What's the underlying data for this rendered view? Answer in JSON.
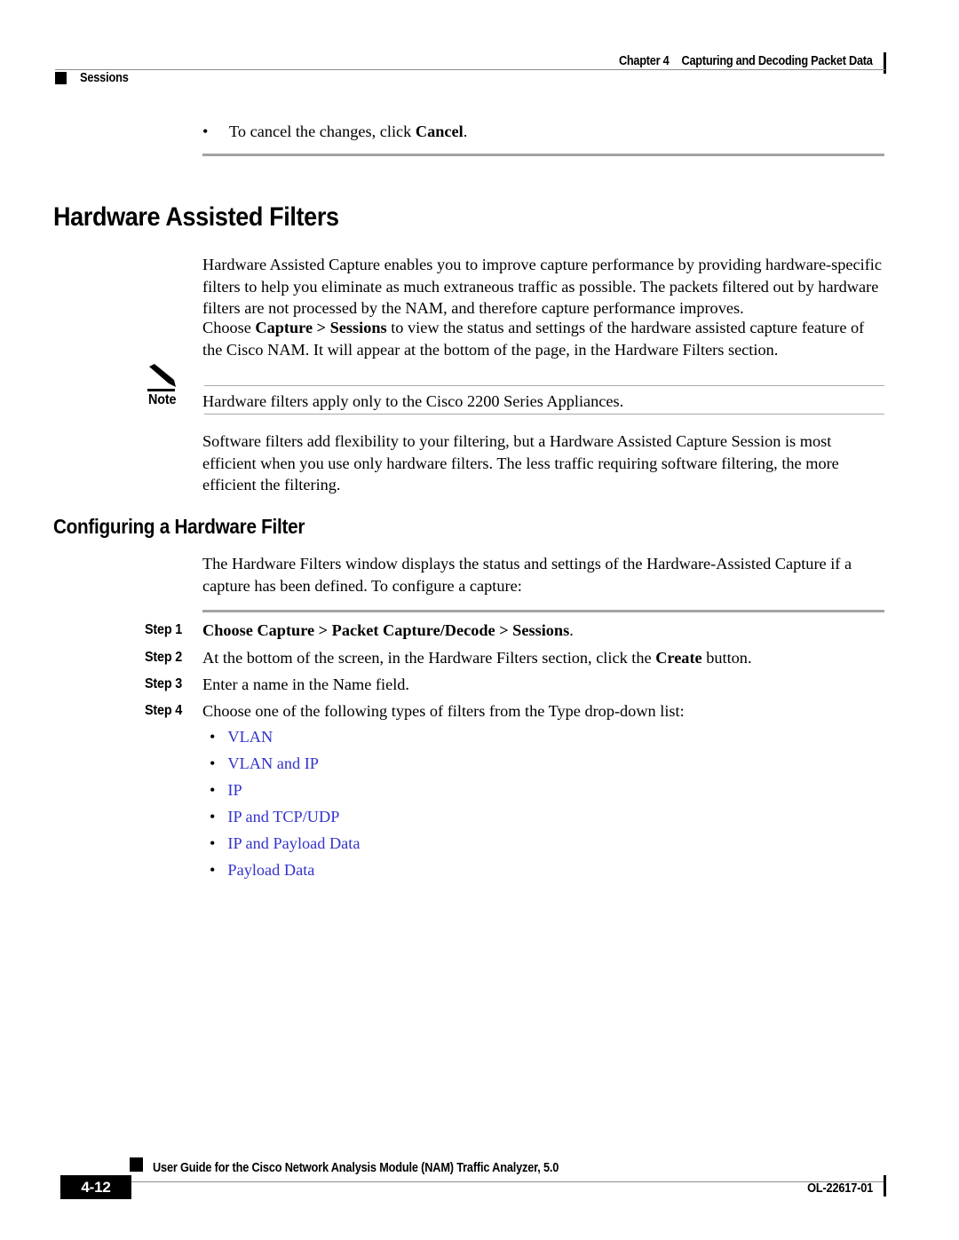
{
  "header": {
    "chapter_number": "Chapter 4",
    "chapter_title": "Capturing and Decoding Packet Data",
    "section_title": "Sessions"
  },
  "intro_bullet": {
    "marker": "•",
    "text_before": "To cancel the changes, click ",
    "bold_word": "Cancel",
    "text_after": "."
  },
  "section": {
    "heading": "Hardware Assisted Filters",
    "paragraph_1": "Hardware Assisted Capture enables you to improve capture performance by providing hardware-specific filters to help you eliminate as much extraneous traffic as possible. The packets filtered out by hardware filters are not processed by the NAM, and therefore capture performance improves.",
    "paragraph_2_before": "Choose ",
    "paragraph_2_bold": "Capture > Sessions",
    "paragraph_2_after": " to view the status and settings of the hardware assisted capture feature of the Cisco NAM. It will appear at the bottom of the page, in the Hardware Filters section.",
    "paragraph_3": "Software filters add flexibility to your filtering, but a Hardware Assisted Capture Session is most efficient when you use only hardware filters. The less traffic requiring software filtering, the more efficient the filtering."
  },
  "note": {
    "icon": "pencil-icon",
    "label": "Note",
    "text": "Hardware filters apply only to the Cisco 2200 Series Appliances."
  },
  "subsection": {
    "heading": "Configuring a Hardware Filter",
    "intro": "The Hardware Filters window displays the status and settings of the Hardware-Assisted Capture if a capture has been defined. To configure a capture:"
  },
  "steps": [
    {
      "label": "Step 1",
      "text_plain_before": "",
      "text_bold": "Choose Capture > Packet Capture/Decode > Sessions",
      "text_plain_after": ".",
      "all_bold": true
    },
    {
      "label": "Step 2",
      "text_plain_before": "At the bottom of the screen, in the Hardware Filters section, click the ",
      "text_bold": "Create",
      "text_plain_after": " button.",
      "all_bold": false
    },
    {
      "label": "Step 3",
      "text_plain_before": "Enter a name in the Name field.",
      "text_bold": "",
      "text_plain_after": "",
      "all_bold": false
    },
    {
      "label": "Step 4",
      "text_plain_before": "Choose one of the following types of filters from the Type drop-down list:",
      "text_bold": "",
      "text_plain_after": "",
      "all_bold": false
    }
  ],
  "filter_type_links": [
    {
      "marker": "•",
      "label": "VLAN"
    },
    {
      "marker": "•",
      "label": "VLAN and IP"
    },
    {
      "marker": "•",
      "label": "IP"
    },
    {
      "marker": "•",
      "label": "IP and TCP/UDP"
    },
    {
      "marker": "•",
      "label": "IP and Payload Data"
    },
    {
      "marker": "•",
      "label": "Payload Data"
    }
  ],
  "footer": {
    "page_number": "4-12",
    "guide_title": "User Guide for the Cisco Network Analysis Module (NAM) Traffic Analyzer, 5.0",
    "doc_id": "OL-22617-01"
  },
  "colors": {
    "link_blue": "#3333cc",
    "rule_gray": "#a3a3a3",
    "thin_rule_gray": "#a8a8a8",
    "text_black": "#000000"
  }
}
